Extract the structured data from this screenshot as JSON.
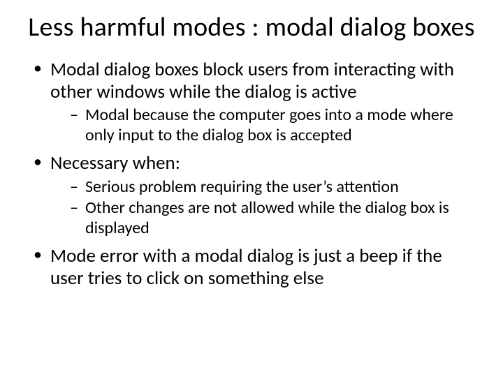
{
  "title": "Less harmful modes : modal dialog boxes",
  "bullets": [
    {
      "text": "Modal dialog boxes block users from interacting with other windows while the dialog is active",
      "sub": [
        "Modal because the computer goes into a mode where only input to the dialog box is accepted"
      ]
    },
    {
      "text": "Necessary when:",
      "sub": [
        "Serious problem requiring the user’s attention",
        "Other changes are not allowed while the dialog box is displayed"
      ]
    },
    {
      "text": "Mode error with a modal dialog is just a beep if the user tries to click on something else",
      "sub": []
    }
  ]
}
